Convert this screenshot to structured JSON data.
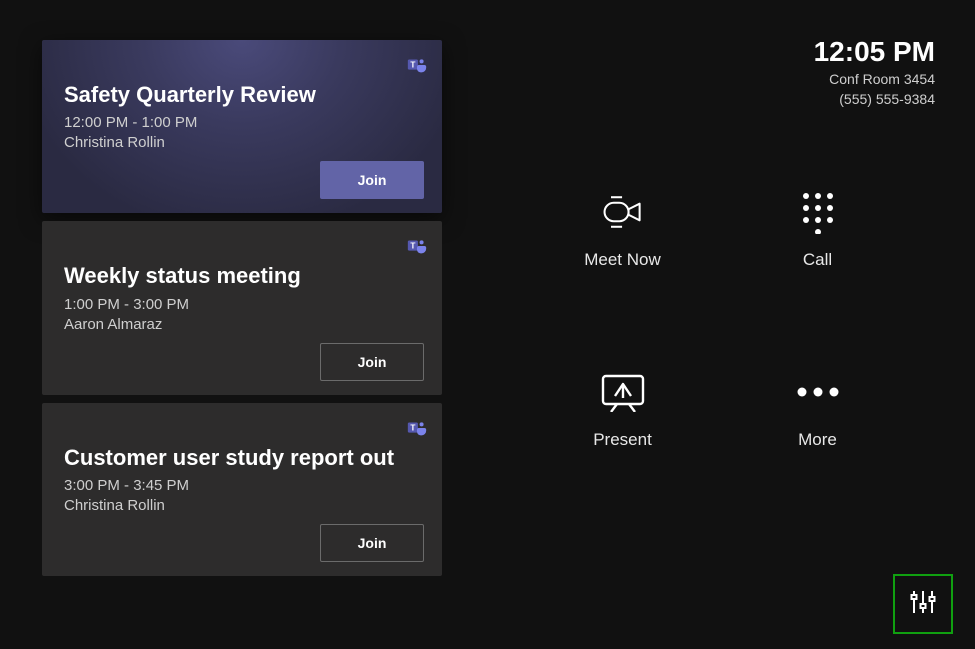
{
  "clock": "12:05 PM",
  "room": {
    "name": "Conf Room 3454",
    "phone": "(555) 555-9384"
  },
  "meetings": [
    {
      "title": "Safety Quarterly Review",
      "time": "12:00 PM - 1:00 PM",
      "organizer": "Christina Rollin",
      "join": "Join"
    },
    {
      "title": "Weekly status meeting",
      "time": "1:00 PM - 3:00 PM",
      "organizer": "Aaron Almaraz",
      "join": "Join"
    },
    {
      "title": "Customer user study report out",
      "time": "3:00 PM - 3:45 PM",
      "organizer": "Christina Rollin",
      "join": "Join"
    }
  ],
  "actions": {
    "meet_now": "Meet Now",
    "call": "Call",
    "present": "Present",
    "more": "More"
  }
}
